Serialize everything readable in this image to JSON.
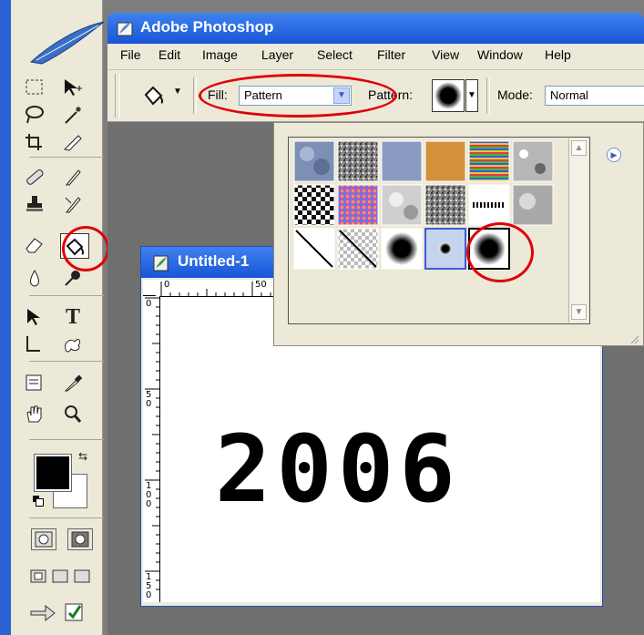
{
  "app": {
    "title": "Adobe Photoshop"
  },
  "menu": [
    "File",
    "Edit",
    "Image",
    "Layer",
    "Select",
    "Filter",
    "View",
    "Window",
    "Help"
  ],
  "options_bar": {
    "fill_label": "Fill:",
    "fill_value": "Pattern",
    "pattern_label": "Pattern:",
    "mode_label": "Mode:",
    "mode_value": "Normal"
  },
  "document": {
    "title": "Untitled-1",
    "content_text": "2006",
    "ruler_top_labels": [
      "0",
      "50"
    ],
    "ruler_left_labels": [
      "0",
      "5 0",
      "1 0 0",
      "1 5 0"
    ]
  },
  "pattern_picker": {
    "selected_pattern": "soft-black-dot",
    "patterns": [
      "bubbles",
      "noise-gray",
      "blue-paper",
      "orange-paper",
      "rainbow-stripes",
      "gray-granite",
      "checker-dither",
      "multicolor-noise",
      "gray-clouds",
      "gray-fibers",
      "stitch-pattern",
      "gray-marble",
      "diagonal-line",
      "diagonal-line-transparent",
      "soft-black-dot",
      "small-dot-highlighted",
      "soft-black-dot-selected"
    ]
  },
  "colors": {
    "accent": "#1f5ad8",
    "highlight": "#e0000a"
  }
}
